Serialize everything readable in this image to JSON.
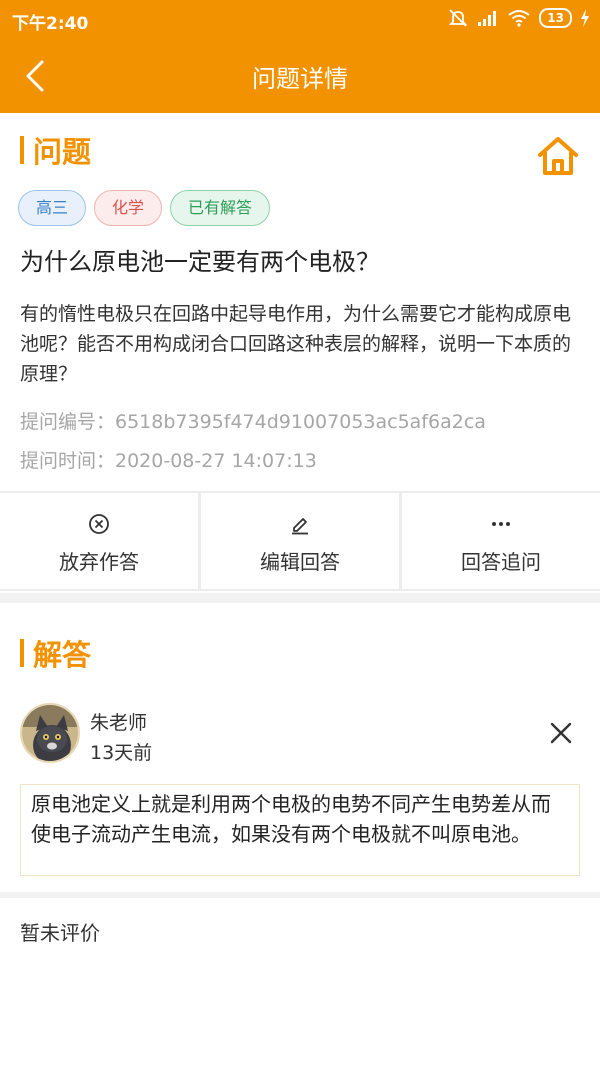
{
  "status_bar": {
    "time": "下午2:40",
    "battery": "13",
    "icons": [
      "mute-icon",
      "signal-icon",
      "wifi-icon",
      "battery-icon",
      "charging-icon"
    ]
  },
  "nav": {
    "title": "问题详情",
    "back_icon": "back-arrow-icon"
  },
  "question_section": {
    "heading": "问题",
    "home_icon": "home-icon",
    "tags": [
      {
        "label": "高三",
        "kind": "grade"
      },
      {
        "label": "化学",
        "kind": "subject"
      },
      {
        "label": "已有解答",
        "kind": "status"
      }
    ],
    "title": "为什么原电池一定要有两个电极？",
    "body": "有的惰性电极只在回路中起导电作用，为什么需要它才能构成原电池呢？能否不用构成闭合口回路这种表层的解释，说明一下本质的原理？",
    "id_line": "提问编号：6518b7395f474d91007053ac5af6a2ca",
    "time_line": "提问时间：2020-08-27 14:07:13"
  },
  "actions": [
    {
      "label": "放弃作答",
      "icon": "circle-x-icon"
    },
    {
      "label": "编辑回答",
      "icon": "pencil-icon"
    },
    {
      "label": "回答追问",
      "icon": "more-dots-icon"
    }
  ],
  "answer_section": {
    "heading": "解答",
    "teacher_name": "朱老师",
    "posted": "13天前",
    "close_icon": "close-icon",
    "content": "原电池定义上就是利用两个电极的电势不同产生电势差从而使电子流动产生电流，如果没有两个电极就不叫原电池。",
    "rating": "暂未评价"
  },
  "colors": {
    "accent": "#f39200",
    "meta_gray": "#a6a6a6"
  }
}
